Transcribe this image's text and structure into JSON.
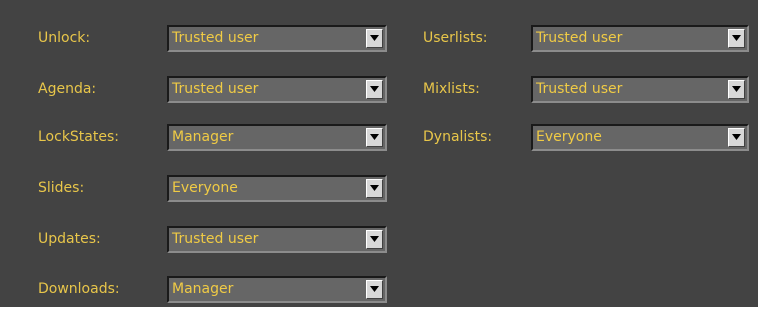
{
  "permissions_left": [
    {
      "label": "Unlock:",
      "value": "Trusted user"
    },
    {
      "label": "Agenda:",
      "value": "Trusted user"
    },
    {
      "label": "LockStates:",
      "value": "Manager"
    },
    {
      "label": "Slides:",
      "value": "Everyone"
    },
    {
      "label": "Updates:",
      "value": "Trusted user"
    },
    {
      "label": "Downloads:",
      "value": "Manager"
    }
  ],
  "permissions_right": [
    {
      "label": "Userlists:",
      "value": "Trusted user"
    },
    {
      "label": "Mixlists:",
      "value": "Trusted user"
    },
    {
      "label": "Dynalists:",
      "value": "Everyone"
    }
  ],
  "icons": {
    "dropdown": "chevron-down-icon"
  },
  "colors": {
    "panel_background": "#434343",
    "label_text": "#e8c64a",
    "select_background": "#666666",
    "select_text": "#f0cb45",
    "dropdown_button": "#d7d7d7"
  }
}
